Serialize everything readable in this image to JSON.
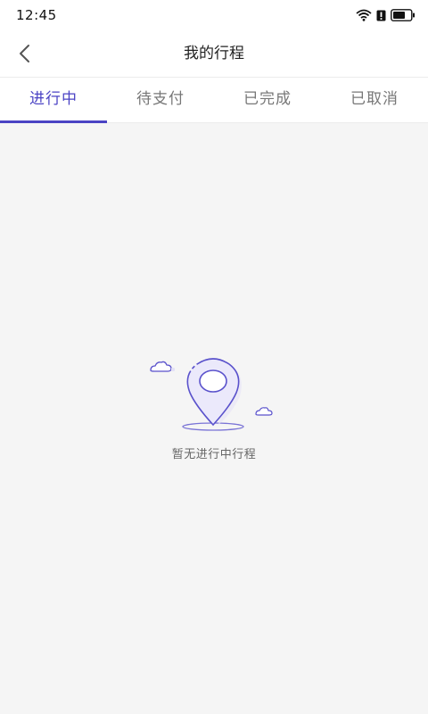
{
  "status_bar": {
    "time": "12:45",
    "icons": [
      "wifi-icon",
      "alert-icon",
      "battery-icon"
    ]
  },
  "header": {
    "back_icon": "chevron-left-icon",
    "title": "我的行程"
  },
  "tabs": [
    {
      "label": "进行中",
      "active": true
    },
    {
      "label": "待支付",
      "active": false
    },
    {
      "label": "已完成",
      "active": false
    },
    {
      "label": "已取消",
      "active": false
    }
  ],
  "empty_state": {
    "icon": "location-pin-icon",
    "message": "暂无进行中行程"
  },
  "colors": {
    "accent": "#4b43c4",
    "background": "#f5f5f5",
    "tab_inactive": "#777777"
  }
}
